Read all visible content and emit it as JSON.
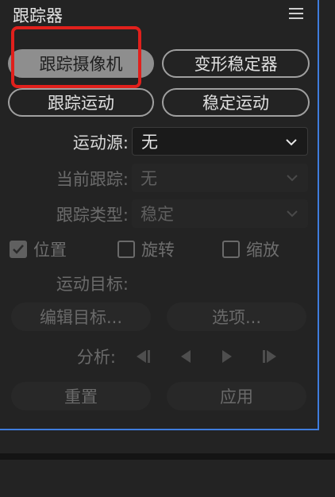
{
  "panel": {
    "title": "跟踪器"
  },
  "buttons": {
    "track_camera": "跟踪摄像机",
    "warp_stabilizer": "变形稳定器",
    "track_motion": "跟踪运动",
    "stabilize_motion": "稳定运动"
  },
  "motion_source": {
    "label": "运动源:",
    "value": "无"
  },
  "current_track": {
    "label": "当前跟踪:",
    "value": "无"
  },
  "track_type": {
    "label": "跟踪类型:",
    "value": "稳定"
  },
  "options": {
    "position": "位置",
    "rotation": "旋转",
    "scale": "缩放",
    "position_checked": true,
    "rotation_checked": false,
    "scale_checked": false
  },
  "motion_target": {
    "label": "运动目标:",
    "edit_target": "编辑目标...",
    "options": "选项..."
  },
  "analyze": {
    "label": "分析:"
  },
  "footer_buttons": {
    "reset": "重置",
    "apply": "应用"
  },
  "colors": {
    "highlight": "#e0201c",
    "panel_border": "#3f7dde"
  }
}
